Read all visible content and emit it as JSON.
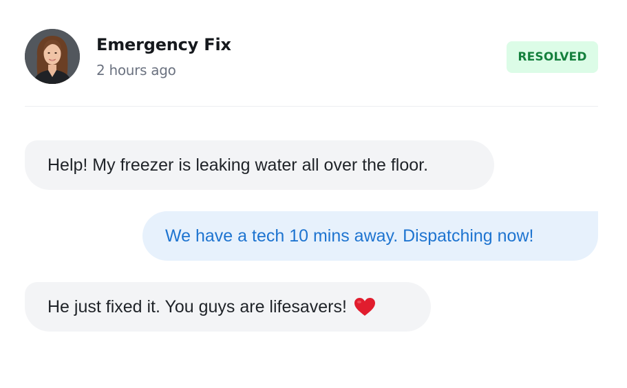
{
  "header": {
    "contact_name": "Emergency Fix",
    "timestamp": "2 hours ago",
    "status_badge": "RESOLVED",
    "avatar_icon": "woman-portrait-avatar"
  },
  "messages": [
    {
      "direction": "incoming",
      "text": "Help! My freezer is leaking water all over the floor."
    },
    {
      "direction": "outgoing",
      "text": "We have a tech 10 mins away. Dispatching now!"
    },
    {
      "direction": "incoming",
      "text": "He just fixed it. You guys are lifesavers!",
      "emoji_icon": "red-heart-icon"
    }
  ],
  "colors": {
    "badge_bg": "#dcfce7",
    "badge_text": "#15803d",
    "incoming_bg": "#f3f4f6",
    "outgoing_bg": "#e7f1fc",
    "outgoing_text": "#1e74d0",
    "heart": "#e11d2e"
  }
}
